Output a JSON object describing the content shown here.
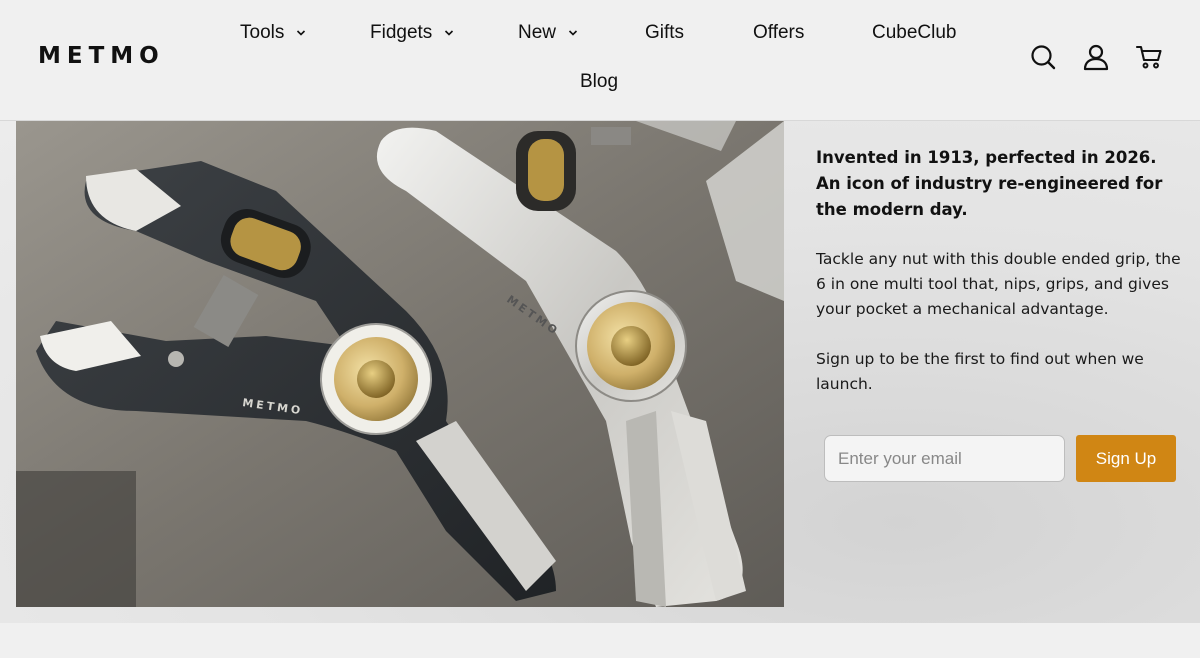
{
  "brand": {
    "logo_text": "METMO"
  },
  "nav": {
    "items": [
      {
        "label": "Tools",
        "has_dropdown": true
      },
      {
        "label": "Fidgets",
        "has_dropdown": true
      },
      {
        "label": "New",
        "has_dropdown": true
      },
      {
        "label": "Gifts",
        "has_dropdown": false
      },
      {
        "label": "Offers",
        "has_dropdown": false
      },
      {
        "label": "CubeClub",
        "has_dropdown": false
      },
      {
        "label": "Blog",
        "has_dropdown": false
      }
    ]
  },
  "header_icons": [
    "search-icon",
    "account-icon",
    "cart-icon"
  ],
  "product": {
    "image_engraving": "METMO",
    "headline": "Invented in 1913, perfected in 2026. An icon of industry re-engineered for the modern day.",
    "description": "Tackle any nut with this double ended grip, the 6 in one multi tool that, nips, grips, and gives your pocket a mechanical advantage.",
    "signup_prompt": "Sign up to be the first to find out when we launch."
  },
  "signup_form": {
    "email_placeholder": "Enter your email",
    "email_value": "",
    "button_label": "Sign Up"
  },
  "colors": {
    "accent": "#d08614",
    "header_bg": "#f0f0f0",
    "text": "#111111"
  }
}
